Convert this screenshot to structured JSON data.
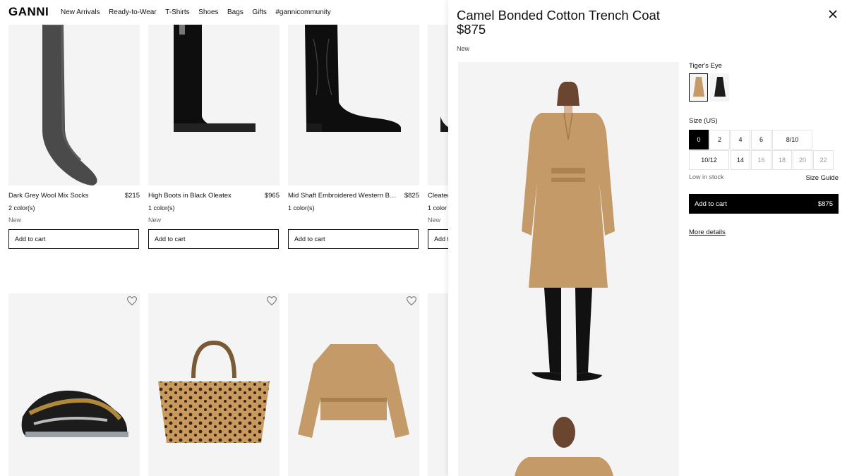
{
  "header": {
    "logo": "GANNI",
    "nav": [
      "New Arrivals",
      "Ready-to-Wear",
      "T-Shirts",
      "Shoes",
      "Bags",
      "Gifts",
      "#gannicommunity"
    ]
  },
  "products_row1": [
    {
      "name": "Dark Grey Wool Mix Socks",
      "price": "$215",
      "colors": "2 color(s)",
      "badge": "New",
      "button": "Add to cart"
    },
    {
      "name": "High Boots in Black Oleatex",
      "price": "$965",
      "colors": "1 color(s)",
      "badge": "New",
      "button": "Add to cart"
    },
    {
      "name": "Mid Shaft Embroidered Western Boots",
      "price": "$825",
      "colors": "1 color(s)",
      "badge": "",
      "button": "Add to cart"
    },
    {
      "name": "Cleated",
      "price": "",
      "colors": "1 color",
      "badge": "New",
      "button": "Add t"
    }
  ],
  "drawer": {
    "title": "Camel Bonded Cotton Trench Coat",
    "price": "$875",
    "badge": "New",
    "color_label": "Tiger's Eye",
    "size_label": "Size (US)",
    "sizes_row1": [
      "0",
      "2",
      "4",
      "6",
      "8/10"
    ],
    "sizes_row2": [
      "10/12",
      "14",
      "16",
      "18",
      "20",
      "22"
    ],
    "stock": "Low in stock",
    "size_guide": "Size Guide",
    "add_to_cart": "Add to cart",
    "add_to_cart_price": "$875",
    "more_details": "More details",
    "colors": {
      "camel": "#c9a06a",
      "black": "#1c1c1c",
      "accent": "#000000"
    }
  }
}
